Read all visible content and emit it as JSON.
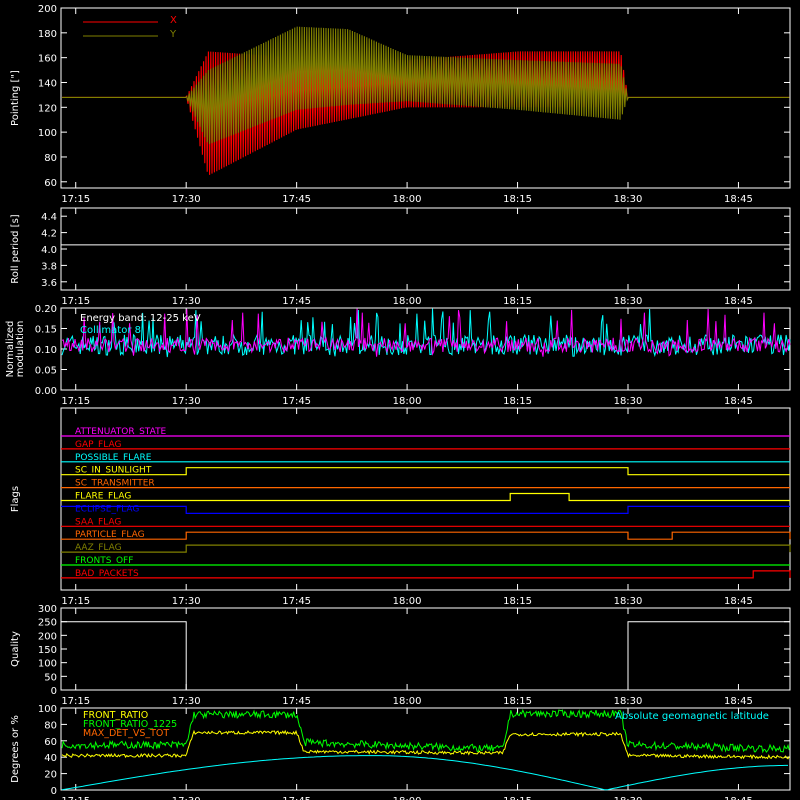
{
  "time_ticks": [
    "17:15",
    "17:30",
    "17:45",
    "18:00",
    "18:15",
    "18:30",
    "18:45"
  ],
  "chart_data": [
    {
      "type": "line",
      "title": "",
      "ylabel": "Pointing [\"]",
      "ylim": [
        55,
        200
      ],
      "yticks": [
        60,
        80,
        100,
        120,
        140,
        160,
        180,
        200
      ],
      "legend": [
        "X",
        "Y"
      ],
      "legend_position": "top-left",
      "colors": {
        "X": "#ff0000",
        "Y": "#808000"
      },
      "series": [
        {
          "name": "X",
          "x": [
            "17:13",
            "17:30",
            "17:33",
            "17:45",
            "18:00",
            "18:15",
            "18:29",
            "18:30",
            "18:52"
          ],
          "min": [
            128,
            128,
            65,
            102,
            120,
            120,
            120,
            128,
            128
          ],
          "max": [
            128,
            128,
            165,
            160,
            158,
            165,
            165,
            128,
            128
          ]
        },
        {
          "name": "Y",
          "x": [
            "17:13",
            "17:30",
            "17:33",
            "17:45",
            "17:52",
            "18:00",
            "18:15",
            "18:29",
            "18:30",
            "18:52"
          ],
          "min": [
            128,
            128,
            90,
            118,
            122,
            125,
            118,
            110,
            128,
            128
          ],
          "max": [
            128,
            128,
            150,
            185,
            183,
            162,
            158,
            155,
            128,
            128
          ]
        }
      ]
    },
    {
      "type": "line",
      "ylabel": "Roll period [s]",
      "ylim": [
        3.5,
        4.5
      ],
      "yticks": [
        3.6,
        3.8,
        4.0,
        4.2,
        4.4
      ],
      "series": [
        {
          "x": [
            "17:13",
            "18:52"
          ],
          "values": [
            4.05,
            4.05
          ]
        }
      ]
    },
    {
      "type": "line",
      "ylabel": "Normalized modulation",
      "ylim": [
        0.0,
        0.2
      ],
      "yticks": [
        0.0,
        0.05,
        0.1,
        0.15,
        0.2
      ],
      "annotations": [
        "Energy band: 12-25 keV",
        "Collimator 8"
      ],
      "colors": {
        "noise": "#ff00ff",
        "collimator": "#00ffff"
      },
      "series": [
        {
          "x": [
            "17:13",
            "18:52"
          ],
          "mean": 0.11,
          "range": [
            0.09,
            0.2
          ]
        }
      ]
    },
    {
      "type": "line",
      "ylabel": "Flags",
      "series": [
        {
          "name": "ATTENUATOR_STATE",
          "color": "#ff00ff",
          "x": [
            "17:13",
            "18:52"
          ],
          "values": [
            0,
            0
          ]
        },
        {
          "name": "GAP_FLAG",
          "color": "#ff0000",
          "x": [
            "17:13",
            "18:52"
          ],
          "values": [
            0,
            0
          ]
        },
        {
          "name": "POSSIBLE_FLARE",
          "color": "#00ffff",
          "x": [
            "17:13",
            "18:52"
          ],
          "values": [
            0,
            0
          ]
        },
        {
          "name": "SC_IN_SUNLIGHT",
          "color": "#ffff00",
          "x": [
            "17:13",
            "17:30",
            "18:30",
            "18:52"
          ],
          "values": [
            0,
            1,
            0,
            0
          ]
        },
        {
          "name": "SC_TRANSMITTER",
          "color": "#ff6600",
          "x": [
            "17:13",
            "18:52"
          ],
          "values": [
            0,
            0
          ]
        },
        {
          "name": "FLARE_FLAG",
          "color": "#ffff00",
          "x": [
            "17:13",
            "18:14",
            "18:22",
            "18:52"
          ],
          "values": [
            0,
            1,
            0,
            0
          ]
        },
        {
          "name": "ECLIPSE_FLAG",
          "color": "#0000ff",
          "x": [
            "17:13",
            "17:30",
            "18:30",
            "18:52"
          ],
          "values": [
            1,
            0,
            1,
            1
          ]
        },
        {
          "name": "SAA_FLAG",
          "color": "#ff0000",
          "x": [
            "17:13",
            "18:52"
          ],
          "values": [
            0,
            0
          ]
        },
        {
          "name": "PARTICLE_FLAG",
          "color": "#ff6600",
          "x": [
            "17:13",
            "17:30",
            "18:30",
            "18:36",
            "18:37",
            "18:40",
            "18:43",
            "18:52"
          ],
          "values": [
            0,
            1,
            0,
            1,
            1,
            1,
            1,
            0
          ]
        },
        {
          "name": "AAZ_FLAG",
          "color": "#808000",
          "x": [
            "17:13",
            "17:30",
            "18:30",
            "18:52"
          ],
          "values": [
            0,
            1,
            1,
            0
          ]
        },
        {
          "name": "FRONTS_OFF",
          "color": "#00ff00",
          "x": [
            "17:13",
            "18:52"
          ],
          "values": [
            0,
            0
          ]
        },
        {
          "name": "BAD_PACKETS",
          "color": "#ff0000",
          "x": [
            "17:13",
            "18:47",
            "18:52"
          ],
          "values": [
            0,
            1,
            0
          ]
        }
      ]
    },
    {
      "type": "line",
      "ylabel": "Quality",
      "ylim": [
        0,
        300
      ],
      "yticks": [
        0,
        50,
        100,
        150,
        200,
        250,
        300
      ],
      "series": [
        {
          "x": [
            "17:13",
            "17:30",
            "17:30",
            "18:30",
            "18:30",
            "18:52"
          ],
          "values": [
            250,
            250,
            0,
            0,
            250,
            250
          ]
        }
      ]
    },
    {
      "type": "line",
      "ylabel": "Degrees or %",
      "ylim": [
        0,
        100
      ],
      "yticks": [
        0,
        20,
        40,
        60,
        80,
        100
      ],
      "legend": [
        "FRONT_RATIO",
        "FRONT_RATIO_1225",
        "MAX_DET_VS_TOT"
      ],
      "annotation": "Absolute geomagnetic latitude",
      "series": [
        {
          "name": "FRONT_RATIO",
          "color": "#ffff00",
          "x": [
            "17:13",
            "17:30",
            "17:31",
            "17:45",
            "17:46",
            "18:13",
            "18:14",
            "18:29",
            "18:30",
            "18:52"
          ],
          "values": [
            42,
            42,
            70,
            70,
            47,
            45,
            68,
            68,
            42,
            40
          ]
        },
        {
          "name": "FRONT_RATIO_1225",
          "color": "#00ff00",
          "x": [
            "17:13",
            "17:30",
            "17:31",
            "17:45",
            "17:46",
            "18:13",
            "18:14",
            "18:29",
            "18:30",
            "18:52"
          ],
          "values": [
            55,
            55,
            92,
            92,
            58,
            50,
            93,
            93,
            55,
            50
          ]
        },
        {
          "name": "MAX_DET_VS_TOT",
          "color": "#ff6600",
          "x": [
            "17:13",
            "18:52"
          ],
          "values": [
            null,
            null
          ]
        },
        {
          "name": "Absolute geomagnetic latitude",
          "color": "#00ffff",
          "x": [
            "17:13",
            "17:55",
            "18:27",
            "18:52"
          ],
          "values": [
            0,
            42,
            0,
            30
          ]
        }
      ]
    }
  ]
}
